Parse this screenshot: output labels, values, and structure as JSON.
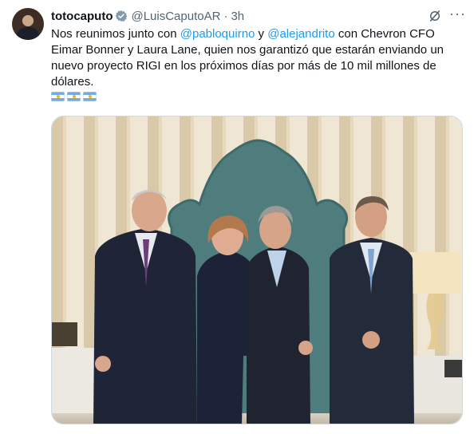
{
  "tweet": {
    "display_name": "totocaputo",
    "handle": "@LuisCaputoAR",
    "separator": "·",
    "time": "3h",
    "text_parts": {
      "p1": "Nos reunimos junto con ",
      "mention1": "@pabloquirno",
      "p2": " y ",
      "mention2": "@alejandrito",
      "p3": " con Chevron CFO Eimar Bonner y Laura Lane, quien nos garantizó que estarán enviando un nuevo proyecto RIGI en los próximos días por más de 10 mil millones de dólares."
    },
    "flags": [
      "argentina-flag",
      "argentina-flag",
      "argentina-flag"
    ],
    "more_label": "···"
  },
  "colors": {
    "text": "#0f1419",
    "secondary": "#536471",
    "link": "#1d9bf0",
    "verified": "#829aab"
  },
  "icons": {
    "verified": "verified-badge-icon",
    "grok": "grok-icon",
    "more": "more-icon"
  }
}
